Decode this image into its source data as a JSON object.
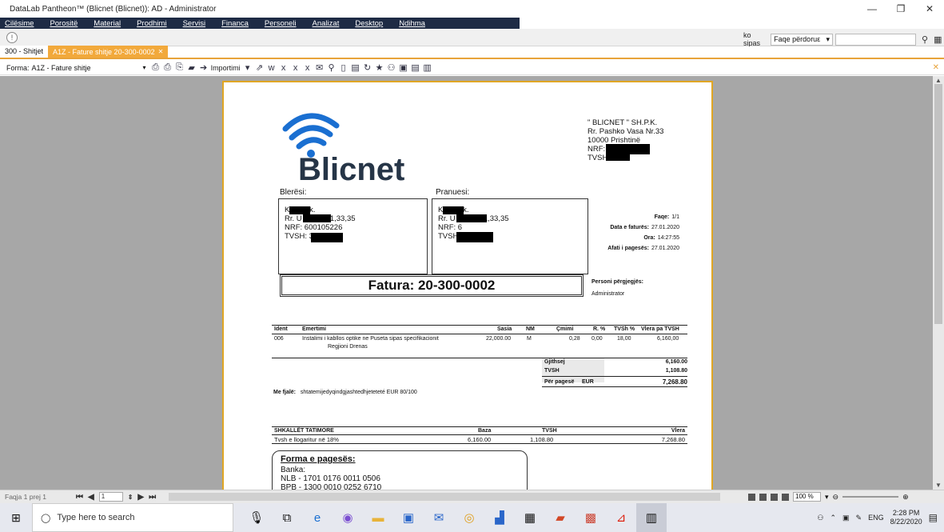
{
  "window": {
    "title": "DataLab Pantheon™  (Blicnet (Blicnet)): AD - Administrator",
    "minimize": "—",
    "maximize": "❐",
    "close": "✕"
  },
  "menu": [
    "Cilësime",
    "Porositë",
    "Material",
    "Prodhimi",
    "Servisi",
    "Financa",
    "Personeli",
    "Analizat",
    "Desktop",
    "Ndihma"
  ],
  "search": {
    "label": "ko sipas",
    "select": "Faqe përdoruε",
    "value": ""
  },
  "tabs": [
    {
      "label": "300 - Shitjet",
      "active": false
    },
    {
      "label": "A1Z - Fature shitje 20-300-0002",
      "active": true
    }
  ],
  "form": {
    "label": "Forma:",
    "value": "A1Z - Fature shitje",
    "import_label": "Importimi"
  },
  "document": {
    "logo_text": "Blicnet",
    "company": [
      "\" BLICNET \" SH.P.K.",
      "Rr. Pashko Vasa Nr.33",
      "10000 Prishtinë",
      "NRF: 81",
      "TVSH: 3"
    ],
    "buyer_label": "Blerësi:",
    "receiver_label": "Pranuesi:",
    "buyer_lines": [
      "K        Sh.p.k.",
      "Rr. U          TI NR.31,33,35",
      "NRF: 600105226",
      "TVSH: 33"
    ],
    "receiver_lines": [
      "K        Sh.p.k.",
      "Rr. U          TI NR.31,33,35",
      "NRF: 6",
      "TVSH: 3                  7"
    ],
    "meta": [
      {
        "label": "Faqe:",
        "value": "1/1"
      },
      {
        "label": "Data e faturës:",
        "value": "27.01.2020"
      },
      {
        "label": "Ora:",
        "value": "14:27:55"
      },
      {
        "label": "Afati i pagesës:",
        "value": "27.01.2020"
      }
    ],
    "invoice_title": "Fatura: 20-300-0002",
    "responsible_label": "Personi përgjegjës:",
    "responsible": "Administrator",
    "table_headers": [
      "Ident",
      "Emertimi",
      "Sasia",
      "NM",
      "Çmimi",
      "R. %",
      "TVSh %",
      "Vlera pa TVSH"
    ],
    "row": {
      "ident": "006",
      "name": "Instalimi i kabllos optike ne Puseta sipas specifikacionit",
      "sub": "Regjioni Drenas",
      "qty": "22,000.00",
      "unit": "M",
      "price": "0,28",
      "disc": "0,00",
      "vat": "18,00",
      "value": "6,160,00"
    },
    "totals": [
      {
        "label": "Gjithsej",
        "cur": "",
        "value": "6,160.00"
      },
      {
        "label": "TVSH",
        "cur": "",
        "value": "1,108.80"
      },
      {
        "label": "Për pagesë",
        "cur": "EUR",
        "value": "7,268.80"
      }
    ],
    "words_label": "Me fjalë:",
    "words": "shtatemijedyqindgjashtedhjeteteté EUR 80/100",
    "tax_headers": [
      "SHKALLËT TATIMORE",
      "Baza",
      "TVSH",
      "Vlera"
    ],
    "tax_row": [
      "Tvsh e llogaritur në 18%",
      "6,160.00",
      "1,108.80",
      "7,268.80"
    ],
    "payment_title": "Forma e pagesës:",
    "payment_lines": [
      "Banka:",
      "NLB -  1701 0176 0011 0506",
      "BPB - 1300 0010 0252 6710"
    ]
  },
  "status": {
    "page": "Faqja 1 prej 1",
    "page_input": "1",
    "zoom": "100 %"
  },
  "taskbar": {
    "search_placeholder": "Type here to search",
    "lang": "ENG",
    "time": "2:28 PM",
    "date": "8/22/2020"
  },
  "colors": {
    "menubar": "#1e2b45",
    "accent": "#f2a93b",
    "logo_blue": "#1a6fd1",
    "logo_dark": "#263547"
  }
}
